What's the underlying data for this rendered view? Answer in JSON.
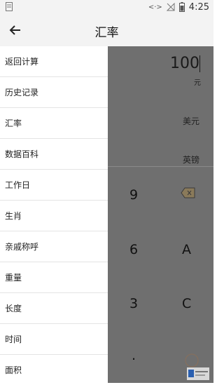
{
  "status_bar": {
    "time": "4:25"
  },
  "app_bar": {
    "title": "汇率"
  },
  "drawer": {
    "items": [
      {
        "label": "返回计算"
      },
      {
        "label": "历史记录"
      },
      {
        "label": "汇率"
      },
      {
        "label": "数据百科"
      },
      {
        "label": "工作日"
      },
      {
        "label": "生肖"
      },
      {
        "label": "亲戚称呼"
      },
      {
        "label": "重量"
      },
      {
        "label": "长度"
      },
      {
        "label": "时间"
      },
      {
        "label": "面积"
      }
    ]
  },
  "calculator": {
    "amount": "100",
    "amount_unit": "元",
    "currencies": [
      "美元",
      "英镑"
    ],
    "keys": {
      "nine": "9",
      "six": "6",
      "a": "A",
      "three": "3",
      "c": "C",
      "dot": "."
    }
  },
  "colors": {
    "drawer_bg": "#ffffff",
    "appbar_bg": "#f3f3f3",
    "scrim": "#6f6f6f",
    "divider": "#e4e4e4"
  },
  "icons": [
    "back-arrow-icon",
    "backspace-icon",
    "battery-icon",
    "signal-off-icon",
    "data-transfer-icon"
  ]
}
